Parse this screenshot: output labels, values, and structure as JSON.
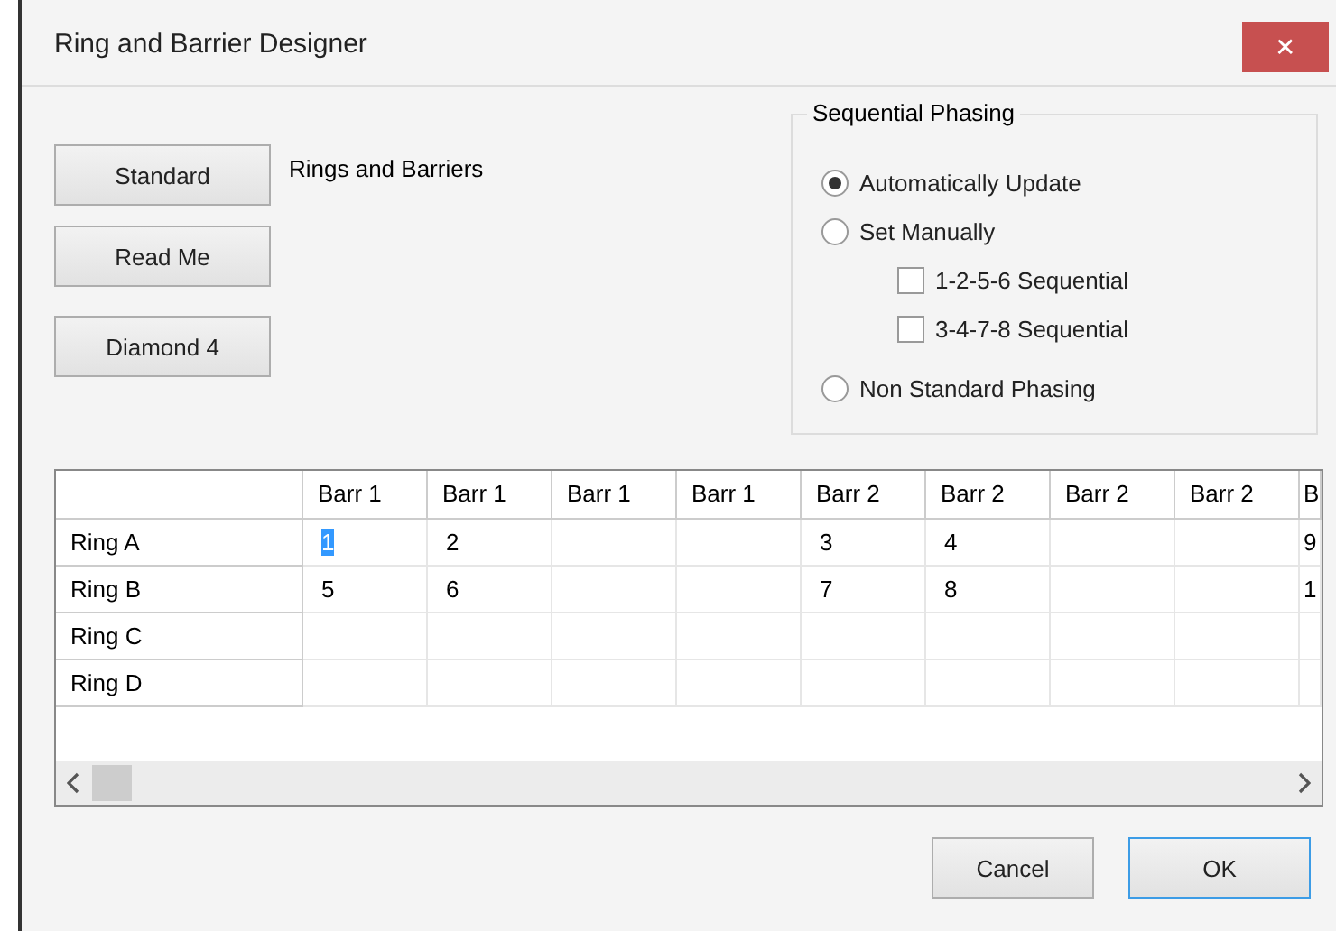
{
  "window": {
    "title": "Ring and Barrier Designer",
    "close": "✕"
  },
  "preset_buttons": [
    "Standard",
    "Read Me",
    "Diamond 4"
  ],
  "preset_label": "Rings and Barriers",
  "sequential_phasing": {
    "title": "Sequential Phasing",
    "options": [
      {
        "kind": "radio",
        "label": "Automatically Update",
        "selected": true
      },
      {
        "kind": "radio",
        "label": "Set Manually",
        "selected": false
      },
      {
        "kind": "checkbox",
        "label": "1-2-5-6 Sequential",
        "checked": false
      },
      {
        "kind": "checkbox",
        "label": "3-4-7-8 Sequential",
        "checked": false
      },
      {
        "kind": "radio",
        "label": "Non Standard Phasing",
        "selected": false
      }
    ]
  },
  "table": {
    "columns": [
      "Barr 1",
      "Barr 1",
      "Barr 1",
      "Barr 1",
      "Barr 2",
      "Barr 2",
      "Barr 2",
      "Barr 2",
      "B"
    ],
    "rows": [
      {
        "label": "Ring A",
        "cells": [
          {
            "text": "1",
            "selected": true
          },
          {
            "text": "2",
            "selected": false
          },
          {
            "text": "",
            "selected": false
          },
          {
            "text": "",
            "selected": false
          },
          {
            "text": "3",
            "selected": false
          },
          {
            "text": "4",
            "selected": false
          },
          {
            "text": "",
            "selected": false
          },
          {
            "text": "",
            "selected": false
          },
          {
            "text": "9",
            "selected": false
          }
        ]
      },
      {
        "label": "Ring B",
        "cells": [
          {
            "text": "5",
            "selected": false
          },
          {
            "text": "6",
            "selected": false
          },
          {
            "text": "",
            "selected": false
          },
          {
            "text": "",
            "selected": false
          },
          {
            "text": "7",
            "selected": false
          },
          {
            "text": "8",
            "selected": false
          },
          {
            "text": "",
            "selected": false
          },
          {
            "text": "",
            "selected": false
          },
          {
            "text": "1",
            "selected": false
          }
        ]
      },
      {
        "label": "Ring C",
        "cells": [
          {
            "text": "",
            "selected": false
          },
          {
            "text": "",
            "selected": false
          },
          {
            "text": "",
            "selected": false
          },
          {
            "text": "",
            "selected": false
          },
          {
            "text": "",
            "selected": false
          },
          {
            "text": "",
            "selected": false
          },
          {
            "text": "",
            "selected": false
          },
          {
            "text": "",
            "selected": false
          },
          {
            "text": "",
            "selected": false
          }
        ]
      },
      {
        "label": "Ring D",
        "cells": [
          {
            "text": "",
            "selected": false
          },
          {
            "text": "",
            "selected": false
          },
          {
            "text": "",
            "selected": false
          },
          {
            "text": "",
            "selected": false
          },
          {
            "text": "",
            "selected": false
          },
          {
            "text": "",
            "selected": false
          },
          {
            "text": "",
            "selected": false
          },
          {
            "text": "",
            "selected": false
          },
          {
            "text": "",
            "selected": false
          }
        ]
      }
    ]
  },
  "footer_buttons": [
    {
      "label": "Cancel",
      "selected": false
    },
    {
      "label": "OK",
      "selected": true
    }
  ]
}
